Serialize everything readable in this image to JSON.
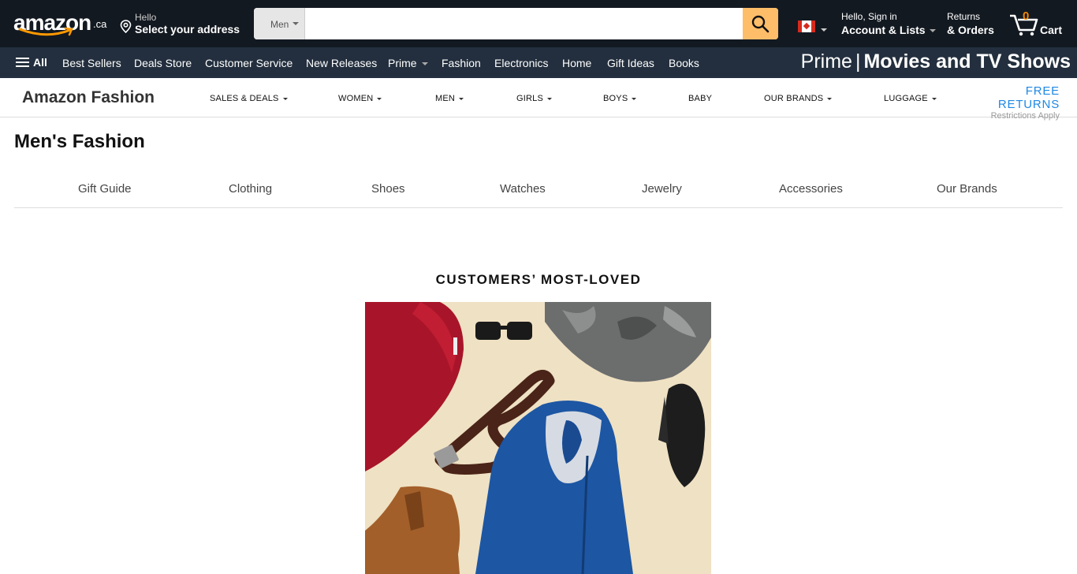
{
  "header": {
    "logo_word": "amazon",
    "logo_tld": ".ca",
    "address_greeting": "Hello",
    "address_prompt": "Select your address",
    "search_category": "Men",
    "search_placeholder": "",
    "account_greeting": "Hello, Sign in",
    "account_label": "Account & Lists",
    "returns_top": "Returns",
    "returns_bottom": "& Orders",
    "cart_count": "0",
    "cart_label": "Cart",
    "icons": [
      "location-pin-icon",
      "search-icon",
      "canada-flag-icon",
      "cart-icon"
    ],
    "colors": {
      "nav_bg": "#131921",
      "subnav_bg": "#232f3e",
      "search_button": "#febd69",
      "cart_count": "#f08804"
    }
  },
  "subnav": {
    "all_label": "All",
    "links": [
      "Best Sellers",
      "Deals Store",
      "Customer Service",
      "New Releases",
      "Prime",
      "Fashion",
      "Electronics",
      "Home",
      "Gift Ideas",
      "Books"
    ],
    "promo_prime": "Prime",
    "promo_divider": "|",
    "promo_text": "Movies and TV Shows"
  },
  "fashion": {
    "logo": "Amazon Fashion",
    "nav": [
      "SALES & DEALS",
      "WOMEN",
      "MEN",
      "GIRLS",
      "BOYS",
      "BABY",
      "OUR BRANDS",
      "LUGGAGE"
    ],
    "free_returns": "FREE RETURNS",
    "restrictions": "Restrictions Apply"
  },
  "page": {
    "title": "Men's Fashion",
    "categories": [
      "Gift Guide",
      "Clothing",
      "Shoes",
      "Watches",
      "Jewelry",
      "Accessories",
      "Our Brands"
    ],
    "section_heading": "CUSTOMERS’ MOST-LOVED"
  }
}
